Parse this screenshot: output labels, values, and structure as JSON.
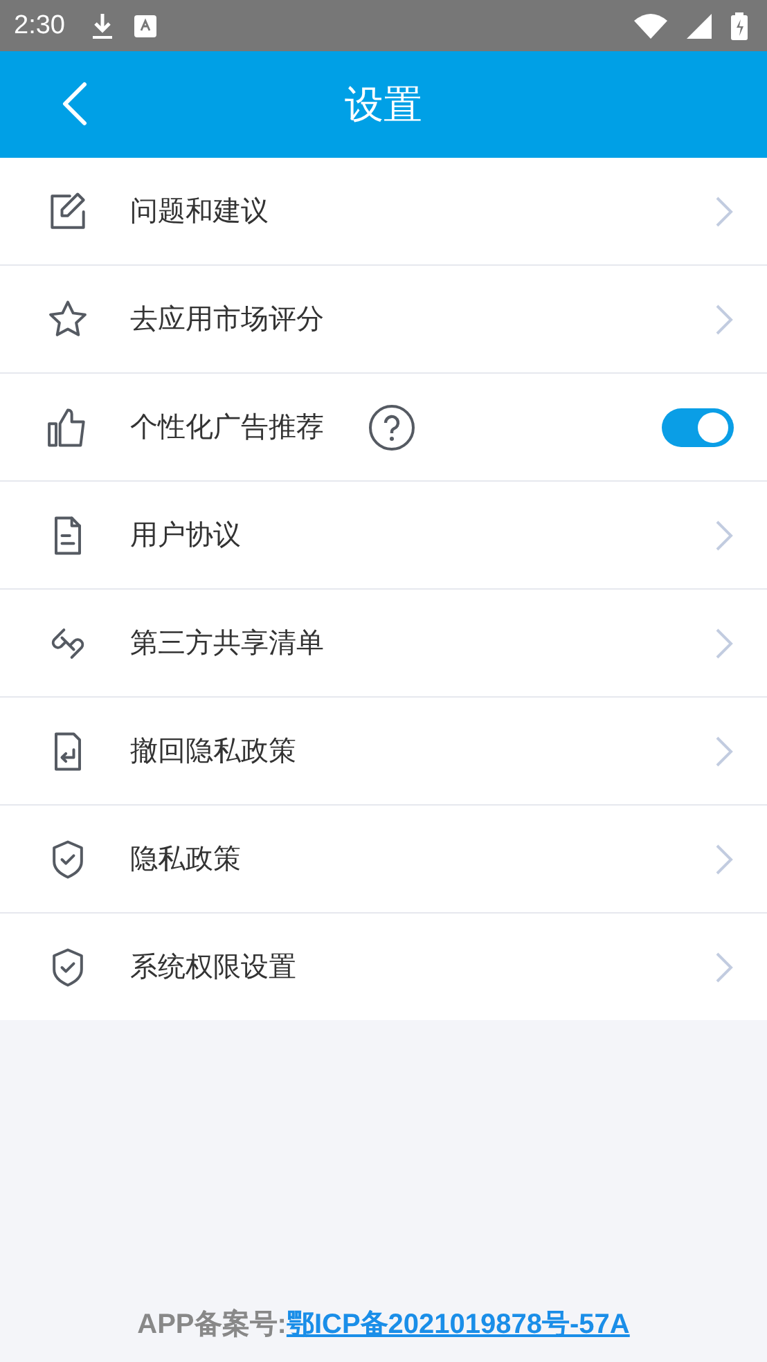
{
  "status_bar": {
    "time": "2:30"
  },
  "header": {
    "title": "设置"
  },
  "items": [
    {
      "kind": "link",
      "label": "问题和建议"
    },
    {
      "kind": "link",
      "label": "去应用市场评分"
    },
    {
      "kind": "toggle",
      "label": "个性化广告推荐",
      "on": true
    },
    {
      "kind": "link",
      "label": "用户协议"
    },
    {
      "kind": "link",
      "label": "第三方共享清单"
    },
    {
      "kind": "link",
      "label": "撤回隐私政策"
    },
    {
      "kind": "link",
      "label": "隐私政策"
    },
    {
      "kind": "link",
      "label": "系统权限设置"
    }
  ],
  "footer": {
    "label": "APP备案号:",
    "link": "鄂ICP备2021019878号-57A"
  }
}
